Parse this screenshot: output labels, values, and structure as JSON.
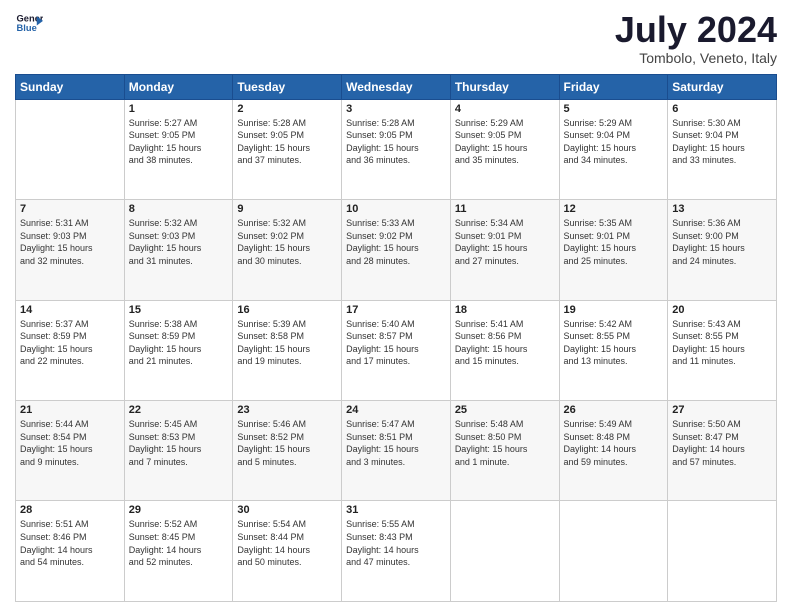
{
  "header": {
    "logo_line1": "General",
    "logo_line2": "Blue",
    "month": "July 2024",
    "location": "Tombolo, Veneto, Italy"
  },
  "days_of_week": [
    "Sunday",
    "Monday",
    "Tuesday",
    "Wednesday",
    "Thursday",
    "Friday",
    "Saturday"
  ],
  "weeks": [
    [
      {
        "day": "",
        "info": ""
      },
      {
        "day": "1",
        "info": "Sunrise: 5:27 AM\nSunset: 9:05 PM\nDaylight: 15 hours\nand 38 minutes."
      },
      {
        "day": "2",
        "info": "Sunrise: 5:28 AM\nSunset: 9:05 PM\nDaylight: 15 hours\nand 37 minutes."
      },
      {
        "day": "3",
        "info": "Sunrise: 5:28 AM\nSunset: 9:05 PM\nDaylight: 15 hours\nand 36 minutes."
      },
      {
        "day": "4",
        "info": "Sunrise: 5:29 AM\nSunset: 9:05 PM\nDaylight: 15 hours\nand 35 minutes."
      },
      {
        "day": "5",
        "info": "Sunrise: 5:29 AM\nSunset: 9:04 PM\nDaylight: 15 hours\nand 34 minutes."
      },
      {
        "day": "6",
        "info": "Sunrise: 5:30 AM\nSunset: 9:04 PM\nDaylight: 15 hours\nand 33 minutes."
      }
    ],
    [
      {
        "day": "7",
        "info": "Sunrise: 5:31 AM\nSunset: 9:03 PM\nDaylight: 15 hours\nand 32 minutes."
      },
      {
        "day": "8",
        "info": "Sunrise: 5:32 AM\nSunset: 9:03 PM\nDaylight: 15 hours\nand 31 minutes."
      },
      {
        "day": "9",
        "info": "Sunrise: 5:32 AM\nSunset: 9:02 PM\nDaylight: 15 hours\nand 30 minutes."
      },
      {
        "day": "10",
        "info": "Sunrise: 5:33 AM\nSunset: 9:02 PM\nDaylight: 15 hours\nand 28 minutes."
      },
      {
        "day": "11",
        "info": "Sunrise: 5:34 AM\nSunset: 9:01 PM\nDaylight: 15 hours\nand 27 minutes."
      },
      {
        "day": "12",
        "info": "Sunrise: 5:35 AM\nSunset: 9:01 PM\nDaylight: 15 hours\nand 25 minutes."
      },
      {
        "day": "13",
        "info": "Sunrise: 5:36 AM\nSunset: 9:00 PM\nDaylight: 15 hours\nand 24 minutes."
      }
    ],
    [
      {
        "day": "14",
        "info": "Sunrise: 5:37 AM\nSunset: 8:59 PM\nDaylight: 15 hours\nand 22 minutes."
      },
      {
        "day": "15",
        "info": "Sunrise: 5:38 AM\nSunset: 8:59 PM\nDaylight: 15 hours\nand 21 minutes."
      },
      {
        "day": "16",
        "info": "Sunrise: 5:39 AM\nSunset: 8:58 PM\nDaylight: 15 hours\nand 19 minutes."
      },
      {
        "day": "17",
        "info": "Sunrise: 5:40 AM\nSunset: 8:57 PM\nDaylight: 15 hours\nand 17 minutes."
      },
      {
        "day": "18",
        "info": "Sunrise: 5:41 AM\nSunset: 8:56 PM\nDaylight: 15 hours\nand 15 minutes."
      },
      {
        "day": "19",
        "info": "Sunrise: 5:42 AM\nSunset: 8:55 PM\nDaylight: 15 hours\nand 13 minutes."
      },
      {
        "day": "20",
        "info": "Sunrise: 5:43 AM\nSunset: 8:55 PM\nDaylight: 15 hours\nand 11 minutes."
      }
    ],
    [
      {
        "day": "21",
        "info": "Sunrise: 5:44 AM\nSunset: 8:54 PM\nDaylight: 15 hours\nand 9 minutes."
      },
      {
        "day": "22",
        "info": "Sunrise: 5:45 AM\nSunset: 8:53 PM\nDaylight: 15 hours\nand 7 minutes."
      },
      {
        "day": "23",
        "info": "Sunrise: 5:46 AM\nSunset: 8:52 PM\nDaylight: 15 hours\nand 5 minutes."
      },
      {
        "day": "24",
        "info": "Sunrise: 5:47 AM\nSunset: 8:51 PM\nDaylight: 15 hours\nand 3 minutes."
      },
      {
        "day": "25",
        "info": "Sunrise: 5:48 AM\nSunset: 8:50 PM\nDaylight: 15 hours\nand 1 minute."
      },
      {
        "day": "26",
        "info": "Sunrise: 5:49 AM\nSunset: 8:48 PM\nDaylight: 14 hours\nand 59 minutes."
      },
      {
        "day": "27",
        "info": "Sunrise: 5:50 AM\nSunset: 8:47 PM\nDaylight: 14 hours\nand 57 minutes."
      }
    ],
    [
      {
        "day": "28",
        "info": "Sunrise: 5:51 AM\nSunset: 8:46 PM\nDaylight: 14 hours\nand 54 minutes."
      },
      {
        "day": "29",
        "info": "Sunrise: 5:52 AM\nSunset: 8:45 PM\nDaylight: 14 hours\nand 52 minutes."
      },
      {
        "day": "30",
        "info": "Sunrise: 5:54 AM\nSunset: 8:44 PM\nDaylight: 14 hours\nand 50 minutes."
      },
      {
        "day": "31",
        "info": "Sunrise: 5:55 AM\nSunset: 8:43 PM\nDaylight: 14 hours\nand 47 minutes."
      },
      {
        "day": "",
        "info": ""
      },
      {
        "day": "",
        "info": ""
      },
      {
        "day": "",
        "info": ""
      }
    ]
  ]
}
